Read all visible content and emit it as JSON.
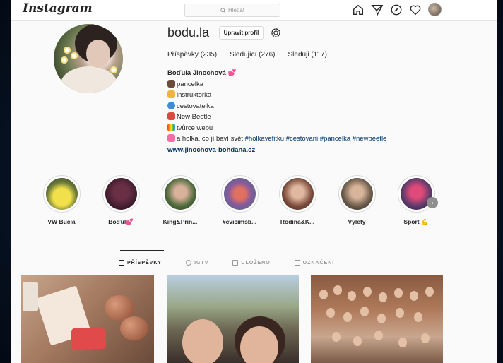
{
  "nav": {
    "logo": "Instagram",
    "search_placeholder": "Hledat"
  },
  "profile": {
    "username": "bodu.la",
    "edit_label": "Upravit profil",
    "stats": [
      {
        "label": "Příspěvky (235)"
      },
      {
        "label": "Sledující (276)"
      },
      {
        "label": "Sleduji (117)"
      }
    ],
    "name": "Boďula Jinochová 💕",
    "bio_lines": [
      "pancelka",
      "instruktorka",
      "cestovatelka",
      "New Beetle",
      "tvůrce webu"
    ],
    "tagline": "a holka, co jí baví svět",
    "hashtags": "#holkavefitku #cestovani #pancelka #newbeetle",
    "website": "www.jinochova-bohdana.cz"
  },
  "highlights": [
    {
      "label": "VW Bucla"
    },
    {
      "label": "Boďul💕"
    },
    {
      "label": "King&Prin..."
    },
    {
      "label": "#cvicimsb..."
    },
    {
      "label": "Rodina&K..."
    },
    {
      "label": "Výlety"
    },
    {
      "label": "Sport 💪"
    }
  ],
  "tabs": [
    {
      "label": "PŘÍSPĚVKY",
      "active": true
    },
    {
      "label": "IGTV"
    },
    {
      "label": "ULOŽENO"
    },
    {
      "label": "OZNAČENÍ"
    }
  ],
  "colors": {
    "link": "#003569",
    "text": "#262626",
    "muted": "#999999"
  }
}
